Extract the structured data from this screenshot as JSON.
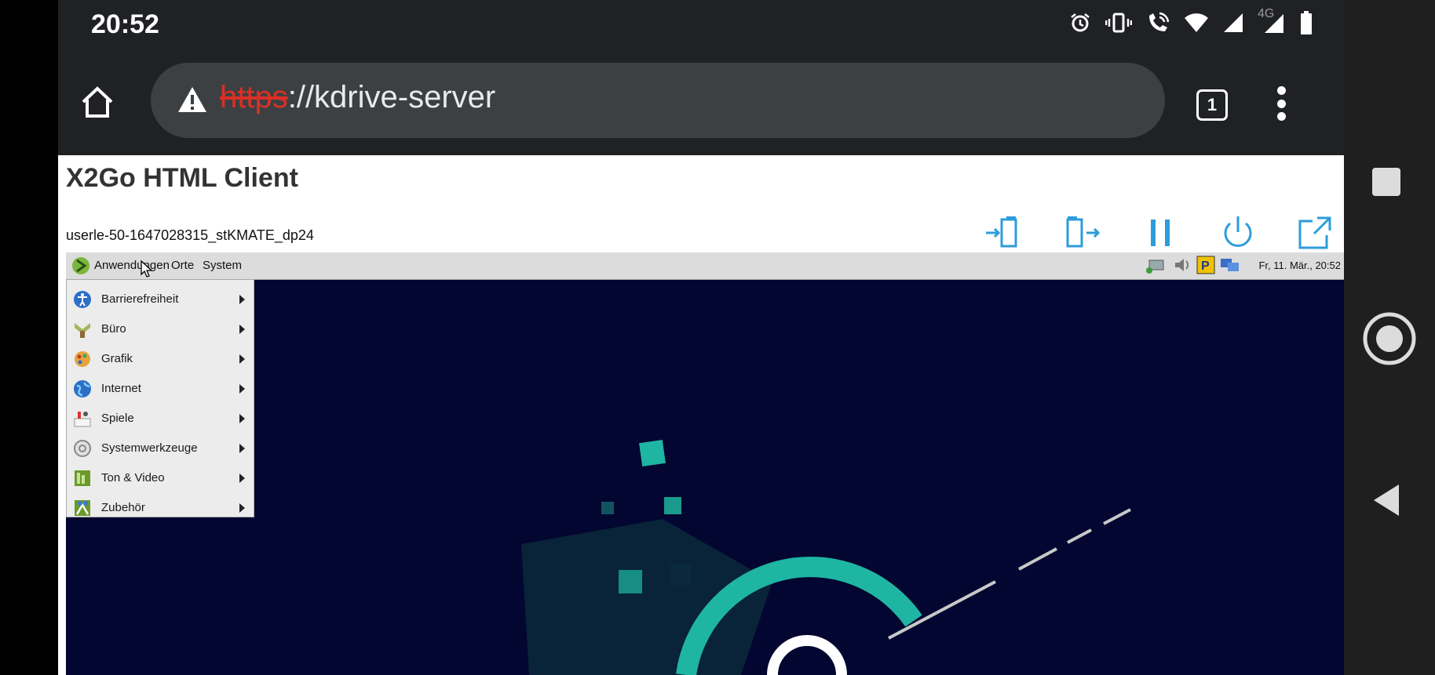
{
  "status_bar": {
    "time": "20:52",
    "network_label": "4G",
    "icons": [
      "alarm-icon",
      "vibrate-icon",
      "wifi-call-icon",
      "wifi-icon",
      "signal-icon",
      "signal-4g-icon",
      "battery-icon"
    ]
  },
  "browser": {
    "url_scheme": "https",
    "url_rest": "://kdrive-server",
    "tab_count": "1",
    "icons": [
      "home-icon",
      "warning-icon",
      "tab-switcher-icon",
      "overflow-menu-icon"
    ]
  },
  "page": {
    "title": "X2Go HTML Client",
    "session_id": "userle-50-1647028315_stKMATE_dp24",
    "controls": [
      "import-icon",
      "export-icon",
      "pause-icon",
      "power-icon",
      "open-external-icon"
    ],
    "accent": "#2d9cdb"
  },
  "desktop": {
    "panel": {
      "menus": [
        "Anwendungen",
        "Orte",
        "System"
      ],
      "clock": "Fr, 11. Mär., 20:52"
    },
    "app_menu": [
      {
        "label": "Barrierefreiheit",
        "icon": "accessibility-icon"
      },
      {
        "label": "Büro",
        "icon": "office-icon"
      },
      {
        "label": "Grafik",
        "icon": "graphics-icon"
      },
      {
        "label": "Internet",
        "icon": "globe-icon"
      },
      {
        "label": "Spiele",
        "icon": "games-icon"
      },
      {
        "label": "Systemwerkzeuge",
        "icon": "system-tools-icon"
      },
      {
        "label": "Ton & Video",
        "icon": "sound-video-icon"
      },
      {
        "label": "Zubehör",
        "icon": "accessories-icon"
      }
    ],
    "wallpaper_colors": {
      "background": "#020630",
      "accent": "#1fb5a3"
    }
  },
  "android_nav": [
    "recents-icon",
    "home-circle-icon",
    "back-icon"
  ]
}
